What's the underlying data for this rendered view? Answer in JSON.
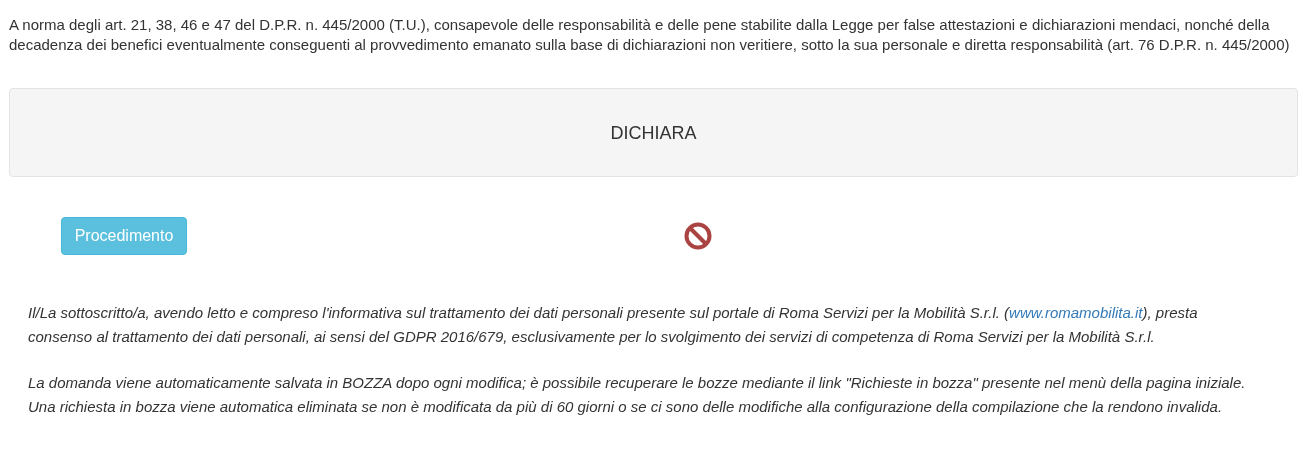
{
  "intro": "A norma degli art. 21, 38, 46 e 47 del D.P.R. n. 445/2000 (T.U.), consapevole delle responsabilità e delle pene stabilite dalla Legge per false attestazioni e dichiarazioni mendaci, nonché della decadenza dei benefici eventualmente conseguenti al provvedimento emanato sulla base di dichiarazioni non veritiere, sotto la sua personale e diretta responsabilità (art. 76 D.P.R. n. 445/2000)",
  "panel": {
    "title": "DICHIARA"
  },
  "procedure": {
    "button": "Procedimento",
    "blocked": true
  },
  "consent": {
    "before": "Il/La sottoscritto/a, avendo letto e compreso l'informativa sul trattamento dei dati personali presente sul portale di Roma Servizi per la Mobilità S.r.l. (",
    "link": "www.romamobilita.it",
    "after": "), presta consenso al trattamento dei dati personali, ai sensi del GDPR 2016/679, esclusivamente per lo svolgimento dei servizi di competenza di Roma Servizi per la Mobilità S.r.l."
  },
  "draft_notice": {
    "lines": [
      "La domanda viene automaticamente salvata in BOZZA dopo ogni modifica; è possibile recuperare le bozze mediante il link \"Richieste in bozza\" presente nel menù della pagina iniziale.",
      "Una richiesta in bozza viene automatica eliminata se non è modificata da più di 60 giorni o se ci sono delle modifiche alla configurazione della compilazione che la rendono invalida."
    ]
  }
}
